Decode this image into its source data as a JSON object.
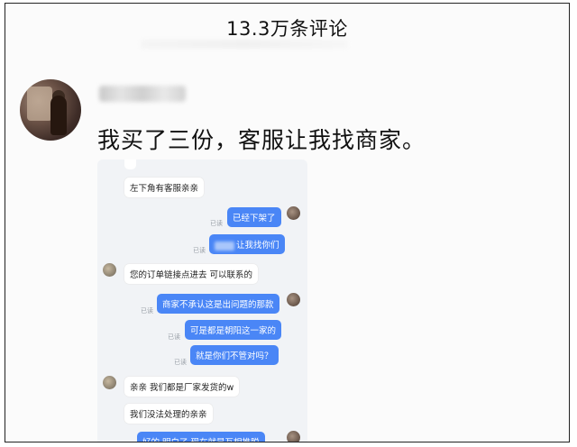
{
  "header": {
    "title": "13.3万条评论"
  },
  "comment": {
    "text": "我买了三份，客服让我找商家。"
  },
  "chat": {
    "top_partial": "...",
    "msg1": "左下角有客服亲亲",
    "msg2": "已经下架了",
    "msg2_read": "已读",
    "msg3": "让我找你们",
    "msg3_read": "已读",
    "msg4": "您的订单链接点进去  可以联系的",
    "msg5": "商家不承认这是出问题的那款",
    "msg5_read": "已读",
    "msg6": "可是都是朝阳这一家的",
    "msg6_read": "已读",
    "msg7": "就是你们不管对吗？",
    "msg7_read": "已读",
    "msg8": "亲亲   我们都是厂家发货的w",
    "msg9": "我们没法处理的亲亲",
    "msg10": "好的    明白了    现在就是互相推脱"
  }
}
